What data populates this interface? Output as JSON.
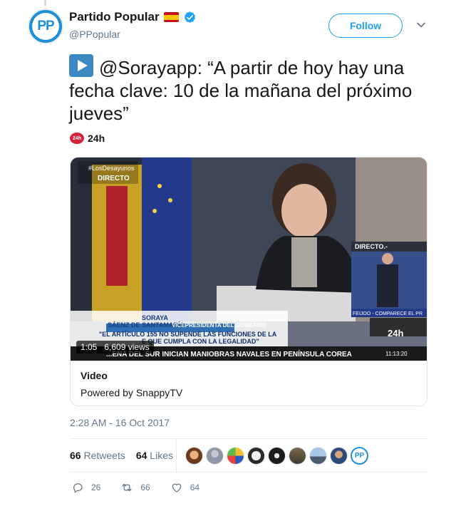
{
  "author": {
    "name": "Partido Popular",
    "handle": "@PPopular",
    "avatar_text": "PP",
    "flag": "Spain",
    "verified": true
  },
  "follow_label": "Follow",
  "tweet": {
    "text": "@Sorayapp: “A partir de hoy hay una fecha clave: 10 de la mañana del próximo jueves”",
    "emoji": "play-button"
  },
  "source": {
    "logo_text": "24h",
    "label": "24h"
  },
  "video": {
    "duration": "1:05",
    "views": "6,609 views",
    "overlay": {
      "tag": "#LosDesayunos",
      "live": "DIRECTO",
      "name1": "SORAYA",
      "name2": "SÁENZ DE SANTAMARÍA",
      "role": "VICEPRESIDENTA DEL GOBIERNO",
      "quote1": "\"EL ARTÍCULO 155 NO SUPENDE LAS FUNCIONES DE LA",
      "quote2": "E QUE CUMPLA CON LA LEGALIDAD\"",
      "ticker": "...ENA DEL SUR INICIAN MANIOBRAS NAVALES EN PENÍNSULA COREA",
      "ticker_time": "11:13:20",
      "pip_live": "DIRECTO.-",
      "pip_caption": "FEIJOO - COMPARECE EL PR",
      "channel": "24h"
    }
  },
  "card": {
    "title": "Video",
    "subtitle": "Powered by SnappyTV"
  },
  "timestamp": "2:28 AM - 16 Oct 2017",
  "stats": {
    "retweets_count": "66",
    "retweets_label": "Retweets",
    "likes_count": "64",
    "likes_label": "Likes"
  },
  "actions": {
    "replies": "26",
    "retweets": "66",
    "likes": "64"
  },
  "colors": {
    "accent": "#1da1f2",
    "text": "#14171a",
    "muted": "#657786",
    "pp_blue": "#1d8fd6"
  }
}
